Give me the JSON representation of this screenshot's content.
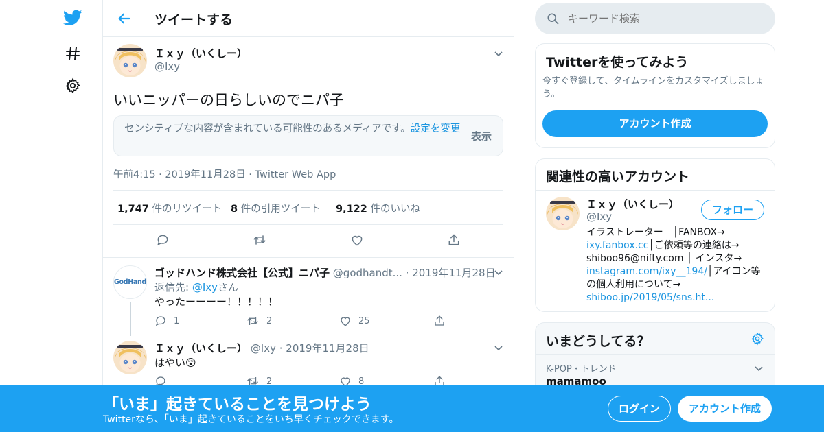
{
  "colors": {
    "accent": "#1da1f2",
    "link": "#1b95e0",
    "muted": "#657786",
    "border": "#e6ecf0"
  },
  "nav": {
    "icons": [
      "twitter-logo-icon",
      "hashtag-icon",
      "settings-icon"
    ]
  },
  "header": {
    "title": "ツイートする"
  },
  "tweet": {
    "name": "Ｉｘｙ（いくしー）",
    "handle": "@Ixy",
    "text": "いいニッパーの日らしいのでニパ子",
    "sensitive_notice": "センシティブな内容が含まれている可能性のあるメディアです。",
    "sensitive_settings_link": "設定を変更",
    "sensitive_show": "表示",
    "time": "午前4:15",
    "date": "2019年11月28日",
    "source": "Twitter Web App",
    "retweets_count": "1,747",
    "retweets_label": "件のリツイート",
    "quotes_count": "8",
    "quotes_label": "件の引用ツイート",
    "likes_count": "9,122",
    "likes_label": "件のいいね"
  },
  "replies": [
    {
      "name": "ゴッドハンド株式会社【公式】ニパ子",
      "handle": "@godhandt...",
      "date": "2019年11月28日",
      "reply_to_prefix": "返信先: ",
      "reply_to_handle": "@Ixy",
      "reply_to_suffix": "さん",
      "text": "やったーーーー！！！！！",
      "avatar_text": "GodHand",
      "reply_count": "1",
      "retweet_count": "2",
      "like_count": "25"
    },
    {
      "name": "Ｉｘｙ（いくしー）",
      "handle": "@Ixy",
      "date": "2019年11月28日",
      "text": "はやい",
      "emoji": "😲",
      "retweet_count": "2",
      "like_count": "8"
    }
  ],
  "search": {
    "placeholder": "キーワード検索"
  },
  "signup_box": {
    "title": "Twitterを使ってみよう",
    "text": "今すぐ登録して、タイムラインをカスタマイズしましょう。",
    "button": "アカウント作成"
  },
  "related": {
    "title": "関連性の高いアカウント",
    "name": "Ｉｘｙ（いくしー）",
    "handle": "@Ixy",
    "follow_button": "フォロー",
    "bio_1": "イラストレーター　│FANBOX→",
    "bio_link_1": "ixy.fanbox.cc",
    "bio_2": "│ご依頼等の連絡は→",
    "bio_3": "shiboo96@nifty.com │ インスタ→",
    "bio_link_2": "instagram.com/ixy__194/",
    "bio_4": "│アイコン等",
    "bio_5": "の個人利用について→",
    "bio_link_3": "shiboo.jp/2019/05/sns.ht..."
  },
  "trends": {
    "title": "いまどうしてる？",
    "item_meta": "K-POP・トレンド",
    "item_name": "mamamoo"
  },
  "banner": {
    "title": "「いま」起きていることを見つけよう",
    "subtitle": "Twitterなら、「いま」起きていることをいち早くチェックできます。",
    "login": "ログイン",
    "signup": "アカウント作成"
  }
}
